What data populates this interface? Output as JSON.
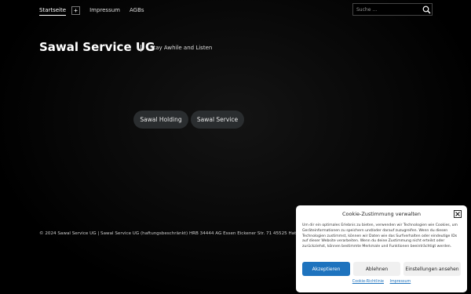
{
  "nav": {
    "items": [
      "Startseite",
      "Impressum",
      "AGBs"
    ],
    "plus_label": "+"
  },
  "search": {
    "placeholder": "Suche …",
    "icon": "search-icon"
  },
  "header": {
    "site_title": "Sawal Service UG",
    "tagline": "Stay Awhile and Listen"
  },
  "links": [
    "Sawal Holding",
    "Sawal Service"
  ],
  "footer": {
    "text": "© 2024 Sawal Service UG | Sawal Service UG (haftungsbeschränkt) HRB 34444 AG Essen Eickener Str. 71 45525 Hattingen"
  },
  "cookie": {
    "title": "Cookie-Zustimmung verwalten",
    "text": "Um dir ein optimales Erlebnis zu bieten, verwenden wir Technologien wie Cookies, um Geräteinformationen zu speichern und/oder darauf zuzugreifen. Wenn du diesen Technologien zustimmst, können wir Daten wie das Surfverhalten oder eindeutige IDs auf dieser Website verarbeiten. Wenn du deine Zustimmung nicht erteilst oder zurückziehst, können bestimmte Merkmale und Funktionen beeinträchtigt werden.",
    "accept": "Akzeptieren",
    "deny": "Ablehnen",
    "preferences": "Einstellungen ansehen",
    "links": [
      "Cookie-Richtlinie",
      "Impressum"
    ],
    "accent_color": "#1e73be"
  }
}
